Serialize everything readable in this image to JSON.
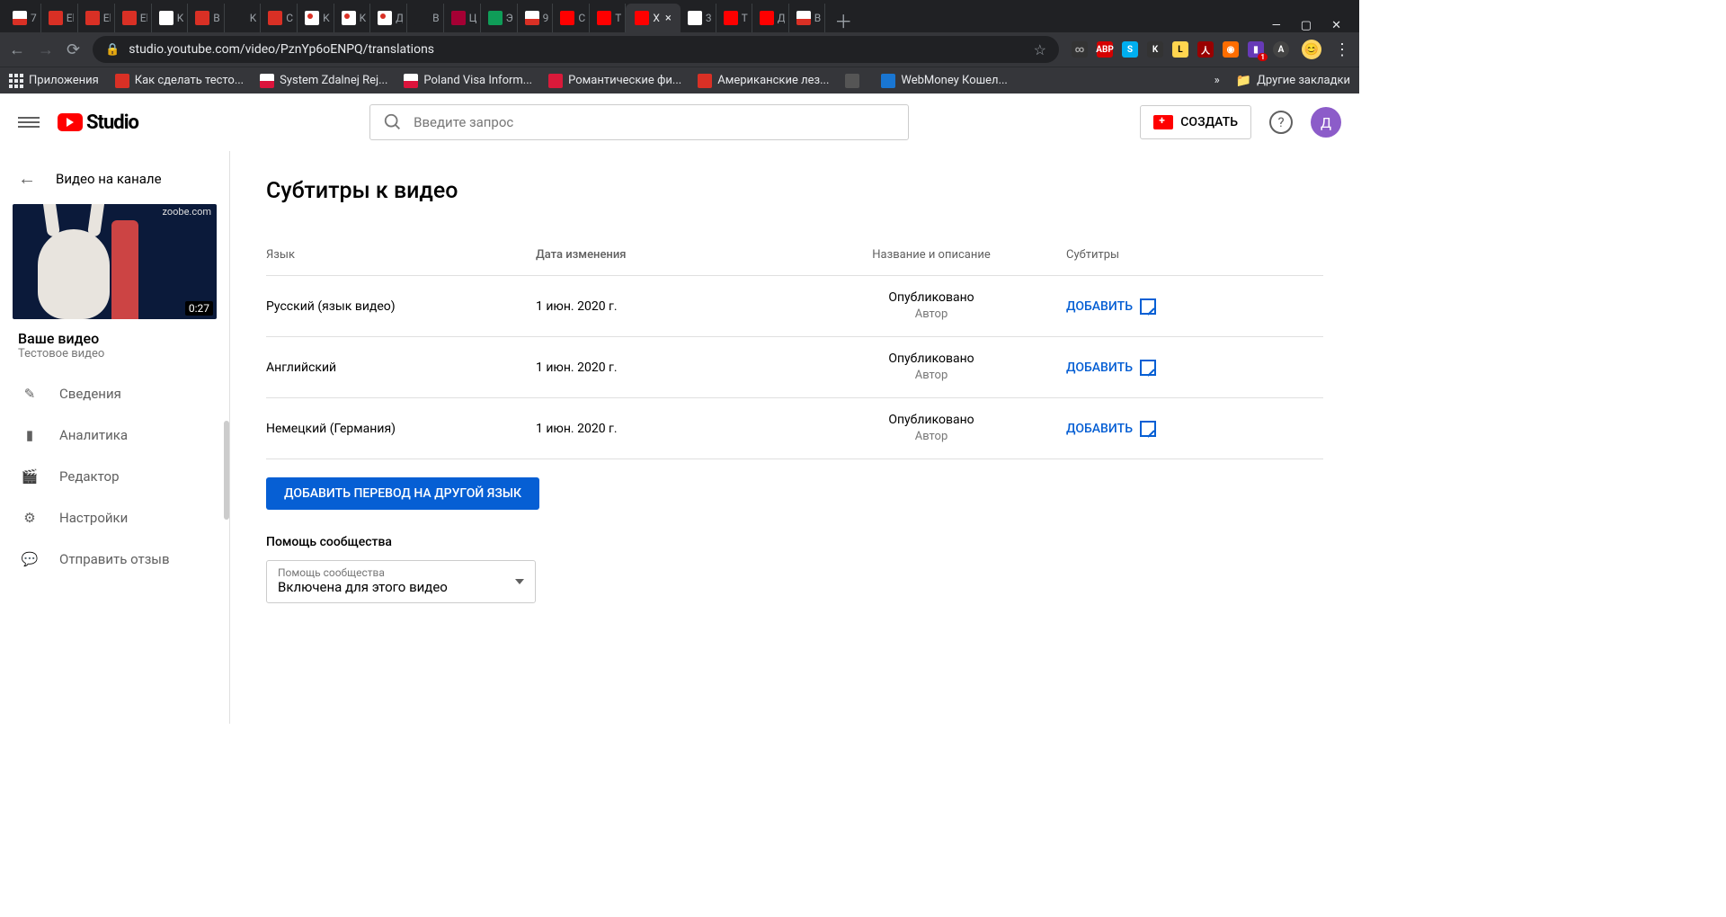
{
  "browser": {
    "tabs": [
      {
        "fav": "f-gm",
        "t": "7"
      },
      {
        "fav": "f-i",
        "t": "El"
      },
      {
        "fav": "f-i",
        "t": "El"
      },
      {
        "fav": "f-i",
        "t": "El"
      },
      {
        "fav": "f-mw",
        "t": "K"
      },
      {
        "fav": "f-i",
        "t": "B"
      },
      {
        "fav": "f-nm",
        "t": "K"
      },
      {
        "fav": "f-i",
        "t": "C"
      },
      {
        "fav": "f-dot",
        "t": "K"
      },
      {
        "fav": "f-dot",
        "t": "K"
      },
      {
        "fav": "f-dot",
        "t": "Д"
      },
      {
        "fav": "f-nm",
        "t": "B"
      },
      {
        "fav": "f-lg",
        "t": "Ц"
      },
      {
        "fav": "f-sh",
        "t": "Э"
      },
      {
        "fav": "f-gm",
        "t": "9"
      },
      {
        "fav": "f-yt",
        "t": "C"
      },
      {
        "fav": "f-yt",
        "t": "T"
      },
      {
        "fav": "f-yt",
        "t": "X",
        "active": true
      },
      {
        "fav": "f-g",
        "t": "3"
      },
      {
        "fav": "f-yt",
        "t": "T"
      },
      {
        "fav": "f-yt",
        "t": "Д"
      },
      {
        "fav": "f-gm",
        "t": "B"
      }
    ],
    "url": "studio.youtube.com/video/PznYp6oENPQ/translations",
    "bookmarks": [
      {
        "cls": "",
        "icon": "apps",
        "label": "Приложения"
      },
      {
        "cls": "bi",
        "bg": "#d93025",
        "label": "Как сделать тесто..."
      },
      {
        "cls": "bi",
        "bg": "#dc143c",
        "flag": "pl",
        "label": "System Zdalnej Rej..."
      },
      {
        "cls": "bi",
        "bg": "#dc143c",
        "flag": "pl",
        "label": "Poland Visa Inform..."
      },
      {
        "cls": "bi",
        "bg": "#d91a3a",
        "label": "Романтические фи..."
      },
      {
        "cls": "bi",
        "bg": "#d93025",
        "label": "Американские лез..."
      },
      {
        "cls": "bi",
        "bg": "#555",
        "label": ""
      },
      {
        "cls": "bi",
        "bg": "#1976d2",
        "label": "WebMoney Кошел..."
      }
    ],
    "other_bookmarks": "Другие закладки",
    "overflow": "»"
  },
  "header": {
    "logo": "Studio",
    "search_placeholder": "Введите запрос",
    "create": "СОЗДАТЬ",
    "avatar": "Д"
  },
  "sidebar": {
    "back": "Видео на канале",
    "thumb_mark": "zoobe.com",
    "duration": "0:27",
    "video_title": "Ваше видео",
    "video_sub": "Тестовое видео",
    "items": [
      {
        "ico": "✎",
        "label": "Сведения"
      },
      {
        "ico": "▮",
        "label": "Аналитика"
      },
      {
        "ico": "🎬",
        "label": "Редактор"
      },
      {
        "ico": "⚙",
        "label": "Настройки"
      },
      {
        "ico": "💬",
        "label": "Отправить отзыв"
      }
    ]
  },
  "main": {
    "title": "Субтитры к видео",
    "cols": {
      "lang": "Язык",
      "date": "Дата изменения",
      "desc": "Название и описание",
      "sub": "Субтитры"
    },
    "rows": [
      {
        "lang": "Русский (язык видео)",
        "date": "1 июн. 2020 г.",
        "desc1": "Опубликовано",
        "desc2": "Автор",
        "action": "ДОБАВИТЬ"
      },
      {
        "lang": "Английский",
        "date": "1 июн. 2020 г.",
        "desc1": "Опубликовано",
        "desc2": "Автор",
        "action": "ДОБАВИТЬ"
      },
      {
        "lang": "Немецкий (Германия)",
        "date": "1 июн. 2020 г.",
        "desc1": "Опубликовано",
        "desc2": "Автор",
        "action": "ДОБАВИТЬ"
      }
    ],
    "add_lang": "ДОБАВИТЬ ПЕРЕВОД НА ДРУГОЙ ЯЗЫК",
    "community_h": "Помощь сообщества",
    "select_label": "Помощь сообщества",
    "select_value": "Включена для этого видео"
  }
}
